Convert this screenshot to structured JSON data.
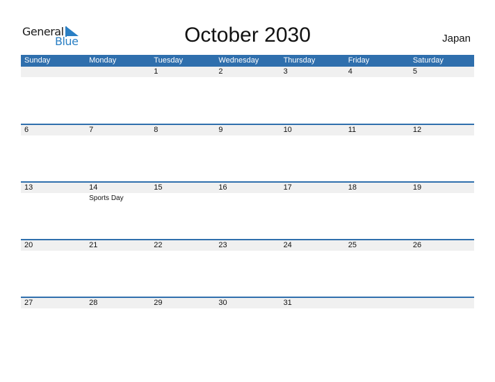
{
  "logo": {
    "word1": "General",
    "word2": "Blue"
  },
  "title": "October 2030",
  "country": "Japan",
  "colors": {
    "accent": "#2f6fad",
    "logo_blue": "#2a7fc4",
    "row_bg": "#f0f0f0"
  },
  "weekdays": [
    "Sunday",
    "Monday",
    "Tuesday",
    "Wednesday",
    "Thursday",
    "Friday",
    "Saturday"
  ],
  "weeks": [
    {
      "days": [
        "",
        "",
        "1",
        "2",
        "3",
        "4",
        "5"
      ],
      "events": [
        "",
        "",
        "",
        "",
        "",
        "",
        ""
      ]
    },
    {
      "days": [
        "6",
        "7",
        "8",
        "9",
        "10",
        "11",
        "12"
      ],
      "events": [
        "",
        "",
        "",
        "",
        "",
        "",
        ""
      ]
    },
    {
      "days": [
        "13",
        "14",
        "15",
        "16",
        "17",
        "18",
        "19"
      ],
      "events": [
        "",
        "Sports Day",
        "",
        "",
        "",
        "",
        ""
      ]
    },
    {
      "days": [
        "20",
        "21",
        "22",
        "23",
        "24",
        "25",
        "26"
      ],
      "events": [
        "",
        "",
        "",
        "",
        "",
        "",
        ""
      ]
    },
    {
      "days": [
        "27",
        "28",
        "29",
        "30",
        "31",
        "",
        ""
      ],
      "events": [
        "",
        "",
        "",
        "",
        "",
        "",
        ""
      ]
    }
  ]
}
